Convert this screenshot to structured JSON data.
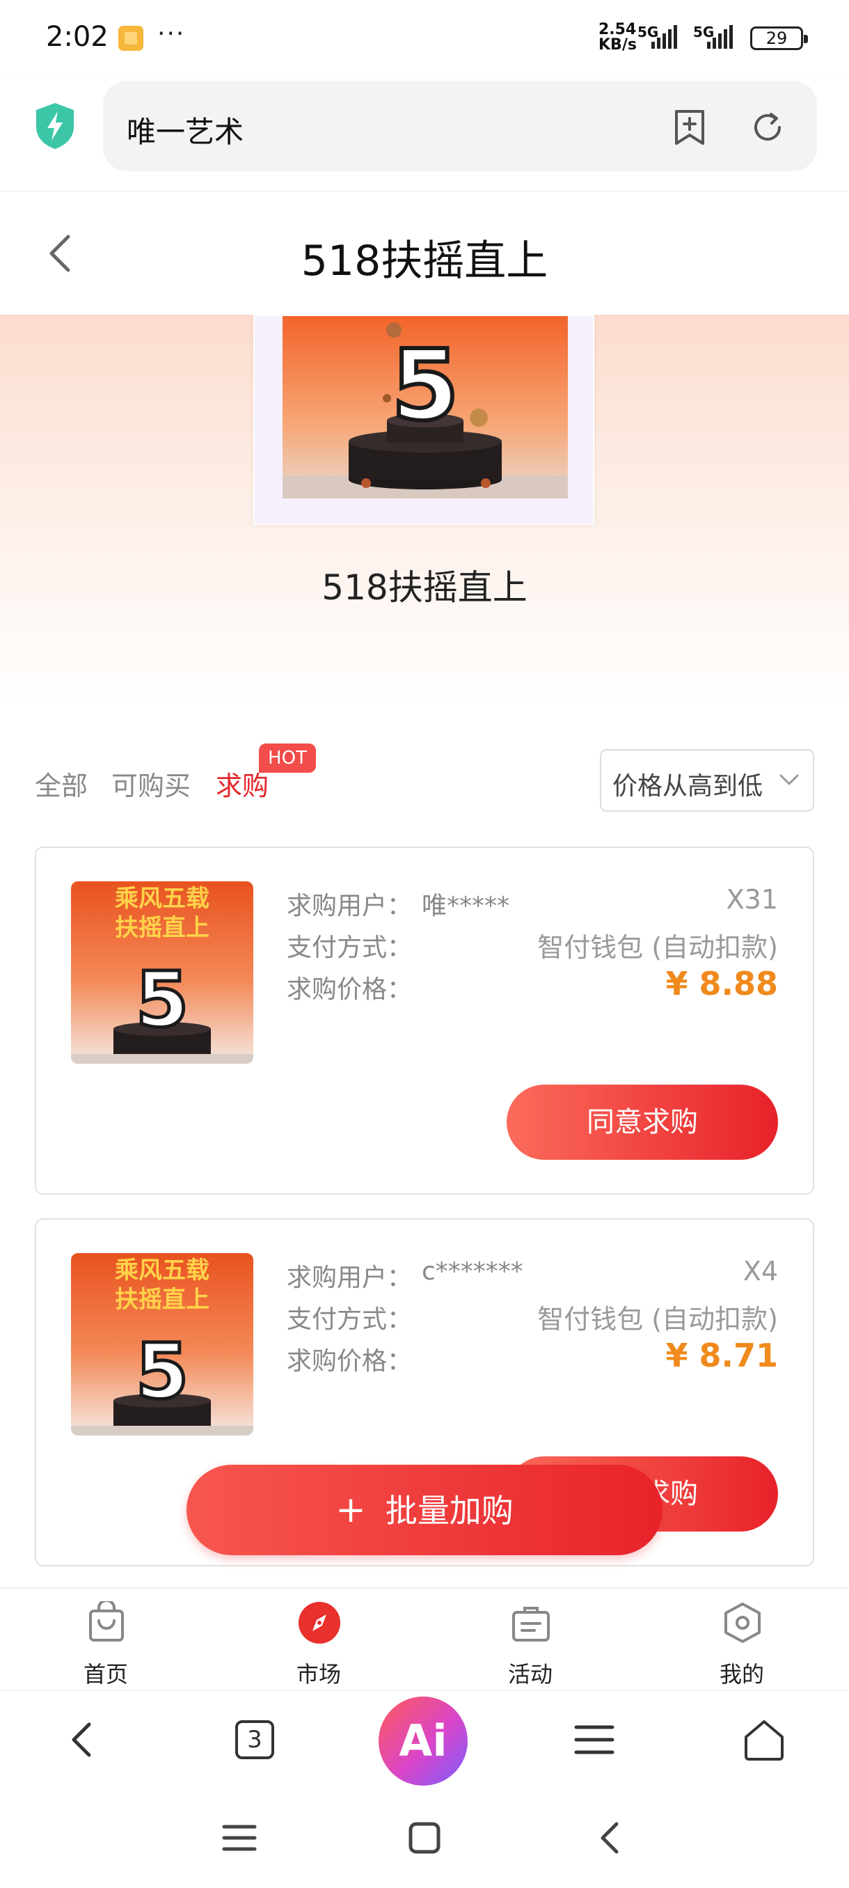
{
  "status_bar": {
    "time": "2:02",
    "more": "···",
    "speed_top": "2.54",
    "speed_unit": "KB/s",
    "net1": "5G",
    "net2": "5G",
    "battery": "29"
  },
  "browser": {
    "address": "唯一艺术",
    "bookmark_icon": "bookmark-add-icon",
    "refresh_icon": "refresh-icon",
    "shield_icon": "shield-bolt-icon"
  },
  "header": {
    "title": "518扶摇直上",
    "back_icon": "chevron-left-icon"
  },
  "hero": {
    "collection_name": "518扶摇直上",
    "art_number": "5"
  },
  "filters": {
    "tabs": [
      {
        "label": "全部",
        "active": false
      },
      {
        "label": "可购买",
        "active": false
      },
      {
        "label": "求购",
        "active": true
      }
    ],
    "hot_badge": "HOT",
    "sort_label": "价格从高到低"
  },
  "orders": [
    {
      "thumb_line1": "乘风五载",
      "thumb_line2": "扶摇直上",
      "thumb_number": "5",
      "user_label": "求购用户：",
      "user": "唯*****",
      "quantity": "X31",
      "pay_label": "支付方式：",
      "pay_method": "智付钱包 (自动扣款)",
      "price_label": "求购价格：",
      "price": "¥ 8.88",
      "action": "同意求购"
    },
    {
      "thumb_line1": "乘风五载",
      "thumb_line2": "扶摇直上",
      "thumb_number": "5",
      "user_label": "求购用户：",
      "user": "c*******",
      "quantity": "X4",
      "pay_label": "支付方式：",
      "pay_method": "智付钱包 (自动扣款)",
      "price_label": "求购价格：",
      "price": "¥ 8.71",
      "action": "同意求购"
    }
  ],
  "batch_button": {
    "plus": "+",
    "label": "批量加购"
  },
  "tab_nav": [
    {
      "label": "首页",
      "icon": "shopping-bag-icon",
      "active": false
    },
    {
      "label": "市场",
      "icon": "compass-icon",
      "active": true
    },
    {
      "label": "活动",
      "icon": "briefcase-icon",
      "active": false
    },
    {
      "label": "我的",
      "icon": "hexagon-icon",
      "active": false
    }
  ],
  "toolbar": {
    "tab_count": "3",
    "ai_label": "Ai"
  },
  "colors": {
    "accent_red": "#e3262a",
    "price_orange": "#f08a1c",
    "shield_teal": "#3cc6a8"
  }
}
